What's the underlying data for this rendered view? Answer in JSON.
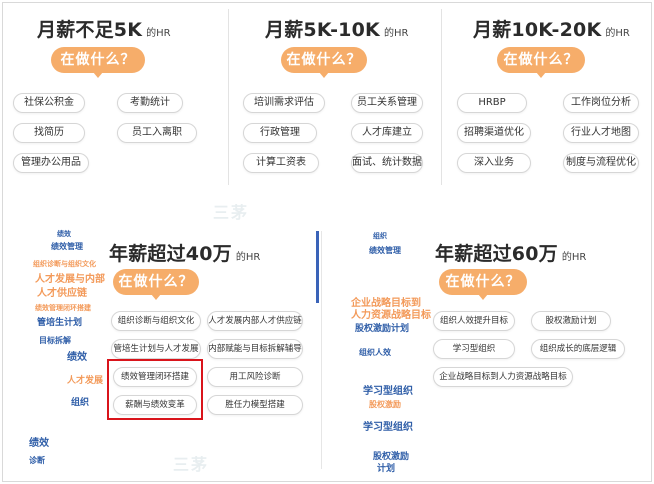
{
  "top": [
    {
      "title": "月薪不足5K",
      "hr": "的HR",
      "button": "在做什么？",
      "tags": [
        "社保公积金",
        "考勤统计",
        "找简历",
        "员工入离职",
        "管理办公用品"
      ]
    },
    {
      "title": "月薪5K-10K",
      "hr": "的HR",
      "button": "在做什么？",
      "tags": [
        "培训需求评估",
        "员工关系管理",
        "行政管理",
        "人才库建立",
        "计算工资表",
        "面试、统计数据"
      ]
    },
    {
      "title": "月薪10K-20K",
      "hr": "的HR",
      "button": "在做什么？",
      "tags": [
        "HRBP",
        "工作岗位分析",
        "招聘渠道优化",
        "行业人才地图",
        "深入业务",
        "制度与流程优化"
      ]
    }
  ],
  "bottom": [
    {
      "title": "年薪超过40万",
      "hr": "的HR",
      "button": "在做什么？",
      "tags": [
        "组织诊断与组织文化",
        "人才发展内部人才供应链",
        "管培生计划与人才发展",
        "内部赋能与目标拆解辅导",
        "绩效管理闭环搭建",
        "用工风险诊断",
        "薪酬与绩效变革",
        "胜任力模型搭建"
      ]
    },
    {
      "title": "年薪超过60万",
      "hr": "的HR",
      "button": "在做什么？",
      "tags": [
        "组织人效提升目标",
        "股权激励计划",
        "学习型组织",
        "组织成长的底层逻辑",
        "企业战略目标到人力资源战略目标"
      ]
    }
  ],
  "wordcloud_left": [
    "绩效",
    "绩效管理",
    "组织诊断与组织文化",
    "人才发展与内部",
    "人才供应链",
    "绩效管理闭环搭建",
    "管培生计划",
    "目标拆解",
    "绩效",
    "人才发展",
    "组织",
    "绩效",
    "诊断"
  ],
  "wordcloud_right": [
    "组织",
    "绩效管理",
    "企业战略目标到",
    "人力资源战略目标",
    "股权激励计划",
    "组织人效",
    "学习型组织",
    "股权激励",
    "学习型组织",
    "股权激励",
    "计划"
  ],
  "watermark": "三茅",
  "colors": {
    "accent": "#f6ad6a",
    "highlight": "#d9141b",
    "divider_blue": "#3a63b8",
    "wordcloud_orange": "#f39a5a",
    "wordcloud_blue": "#2f5ea8"
  }
}
